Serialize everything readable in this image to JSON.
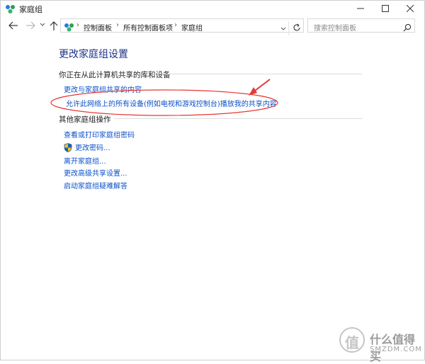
{
  "window": {
    "title": "家庭组"
  },
  "address": {
    "crumbs": [
      "控制面板",
      "所有控制面板项",
      "家庭组"
    ]
  },
  "search": {
    "placeholder": "搜索控制面板"
  },
  "main": {
    "title": "更改家庭组设置",
    "sharing_section": {
      "header": "你正在从此计算机共享的库和设备",
      "links": [
        "更改与家庭组共享的内容",
        "允许此网络上的所有设备(例如电视和游戏控制台)播放我的共享内容"
      ]
    },
    "other_section": {
      "header": "其他家庭组操作",
      "links": [
        "查看或打印家庭组密码",
        "更改密码...",
        "离开家庭组...",
        "更改高级共享设置...",
        "启动家庭组疑难解答"
      ]
    }
  },
  "annotation": {
    "color": "#e53935"
  },
  "watermark": {
    "glyph": "值",
    "brand_cn": "什么值得买",
    "brand_en": "SMZDM.COM"
  },
  "colors": {
    "link": "#0b50c8",
    "title": "#1e3287",
    "accent_green": "#2e9e5a",
    "accent_blue": "#2a7bd6"
  }
}
